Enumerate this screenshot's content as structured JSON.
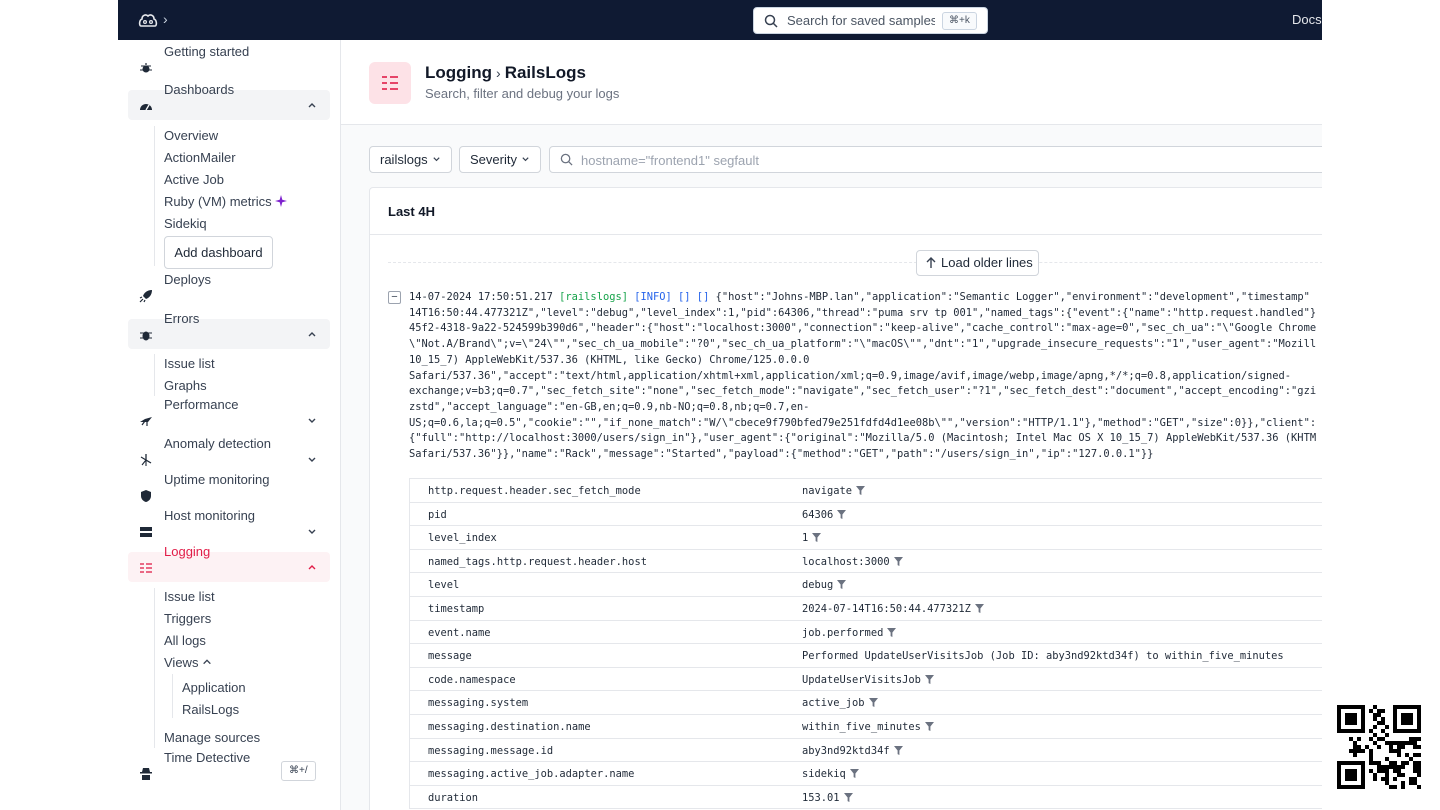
{
  "topbar": {
    "search_placeholder": "Search for saved samples",
    "search_shortcut": "⌘+k",
    "docs_label": "Docs"
  },
  "sidebar": {
    "groups": [
      {
        "label": "Getting started",
        "icon": "bug-icon"
      },
      {
        "label": "Dashboards",
        "icon": "gauge-icon",
        "expanded": true
      },
      {
        "label": "Deploys",
        "icon": "rocket-icon"
      },
      {
        "label": "Errors",
        "icon": "beetle-icon",
        "expanded": true
      },
      {
        "label": "Performance",
        "icon": "ant-icon"
      },
      {
        "label": "Anomaly detection",
        "icon": "radar-icon"
      },
      {
        "label": "Uptime monitoring",
        "icon": "shield-icon"
      },
      {
        "label": "Host monitoring",
        "icon": "server-icon"
      },
      {
        "label": "Logging",
        "icon": "list-icon",
        "expanded": true,
        "active": true
      },
      {
        "label": "Time Detective",
        "icon": "detective-icon"
      }
    ],
    "dashboards_items": [
      "Overview",
      "ActionMailer",
      "Active Job",
      "Ruby (VM) metrics",
      "Sidekiq"
    ],
    "add_dashboard_label": "Add dashboard",
    "errors_items": [
      "Issue list",
      "Graphs"
    ],
    "logging_items": [
      "Issue list",
      "Triggers",
      "All logs",
      "Views"
    ],
    "views_items": [
      "Application",
      "RailsLogs"
    ],
    "manage_sources_label": "Manage sources",
    "shortcut": "⌘+/"
  },
  "header": {
    "breadcrumb_parent": "Logging",
    "breadcrumb_current": "RailsLogs",
    "subtitle": "Search, filter and debug your logs"
  },
  "filters": {
    "source": "railslogs",
    "severity": "Severity",
    "query_placeholder": "hostname=\"frontend1\" segfault"
  },
  "panel": {
    "range_label": "Last 4H",
    "load_older_label": "Load older lines",
    "collapse_symbol": "−",
    "log_timestamp": "14-07-2024 17:50:51.217",
    "log_source": "[railslogs]",
    "log_level": "[INFO] [] []",
    "log_lines": [
      " {\"host\":\"Johns-MBP.lan\",\"application\":\"Semantic Logger\",\"environment\":\"development\",\"timestamp\"",
      "14T16:50:44.477321Z\",\"level\":\"debug\",\"level_index\":1,\"pid\":64306,\"thread\":\"puma srv tp 001\",\"named_tags\":{\"event\":{\"name\":\"http.request.handled\"}",
      "45f2-4318-9a22-524599b390d6\",\"header\":{\"host\":\"localhost:3000\",\"connection\":\"keep-alive\",\"cache_control\":\"max-age=0\",\"sec_ch_ua\":\"\\\"Google Chrome",
      "\\\"Not.A/Brand\\\";v=\\\"24\\\"\",\"sec_ch_ua_mobile\":\"?0\",\"sec_ch_ua_platform\":\"\\\"macOS\\\"\",\"dnt\":\"1\",\"upgrade_insecure_requests\":\"1\",\"user_agent\":\"Mozill",
      "10_15_7) AppleWebKit/537.36 (KHTML, like Gecko) Chrome/125.0.0.0",
      "Safari/537.36\",\"accept\":\"text/html,application/xhtml+xml,application/xml;q=0.9,image/avif,image/webp,image/apng,*/*;q=0.8,application/signed-",
      "exchange;v=b3;q=0.7\",\"sec_fetch_site\":\"none\",\"sec_fetch_mode\":\"navigate\",\"sec_fetch_user\":\"?1\",\"sec_fetch_dest\":\"document\",\"accept_encoding\":\"gzi",
      "zstd\",\"accept_language\":\"en-GB,en;q=0.9,nb-NO;q=0.8,nb;q=0.7,en-",
      "US;q=0.6,la;q=0.5\",\"cookie\":\"\",\"if_none_match\":\"W/\\\"cbece9f790bfed79e251fdfd4d1ee08b\\\"\",\"version\":\"HTTP/1.1\"},\"method\":\"GET\",\"size\":0}},\"client\":",
      "{\"full\":\"http://localhost:3000/users/sign_in\"},\"user_agent\":{\"original\":\"Mozilla/5.0 (Macintosh; Intel Mac OS X 10_15_7) AppleWebKit/537.36 (KHTM",
      "Safari/537.36\"}},\"name\":\"Rack\",\"message\":\"Started\",\"payload\":{\"method\":\"GET\",\"path\":\"/users/sign_in\",\"ip\":\"127.0.0.1\"}}"
    ],
    "attributes": [
      {
        "key": "http.request.header.sec_fetch_mode",
        "value": "navigate",
        "filter": true
      },
      {
        "key": "pid",
        "value": "64306",
        "filter": true
      },
      {
        "key": "level_index",
        "value": "1",
        "filter": true
      },
      {
        "key": "named_tags.http.request.header.host",
        "value": "localhost:3000",
        "filter": true
      },
      {
        "key": "level",
        "value": "debug",
        "filter": true
      },
      {
        "key": "timestamp",
        "value": "2024-07-14T16:50:44.477321Z",
        "filter": true
      },
      {
        "key": "event.name",
        "value": "job.performed",
        "filter": true
      },
      {
        "key": "message",
        "value": "Performed UpdateUserVisitsJob (Job ID: aby3nd92ktd34f) to within_five_minutes",
        "filter": false
      },
      {
        "key": "code.namespace",
        "value": "UpdateUserVisitsJob",
        "filter": true
      },
      {
        "key": "messaging.system",
        "value": "active_job",
        "filter": true
      },
      {
        "key": "messaging.destination.name",
        "value": "within_five_minutes",
        "filter": true
      },
      {
        "key": "messaging.message.id",
        "value": "aby3nd92ktd34f",
        "filter": true
      },
      {
        "key": "messaging.active_job.adapter.name",
        "value": "sidekiq",
        "filter": true
      },
      {
        "key": "duration",
        "value": "153.01",
        "filter": true
      }
    ]
  },
  "colors": {
    "topbar": "#0f1a33",
    "accent": "#e11d48",
    "log_source": "#16a34a",
    "log_level": "#2563eb"
  }
}
